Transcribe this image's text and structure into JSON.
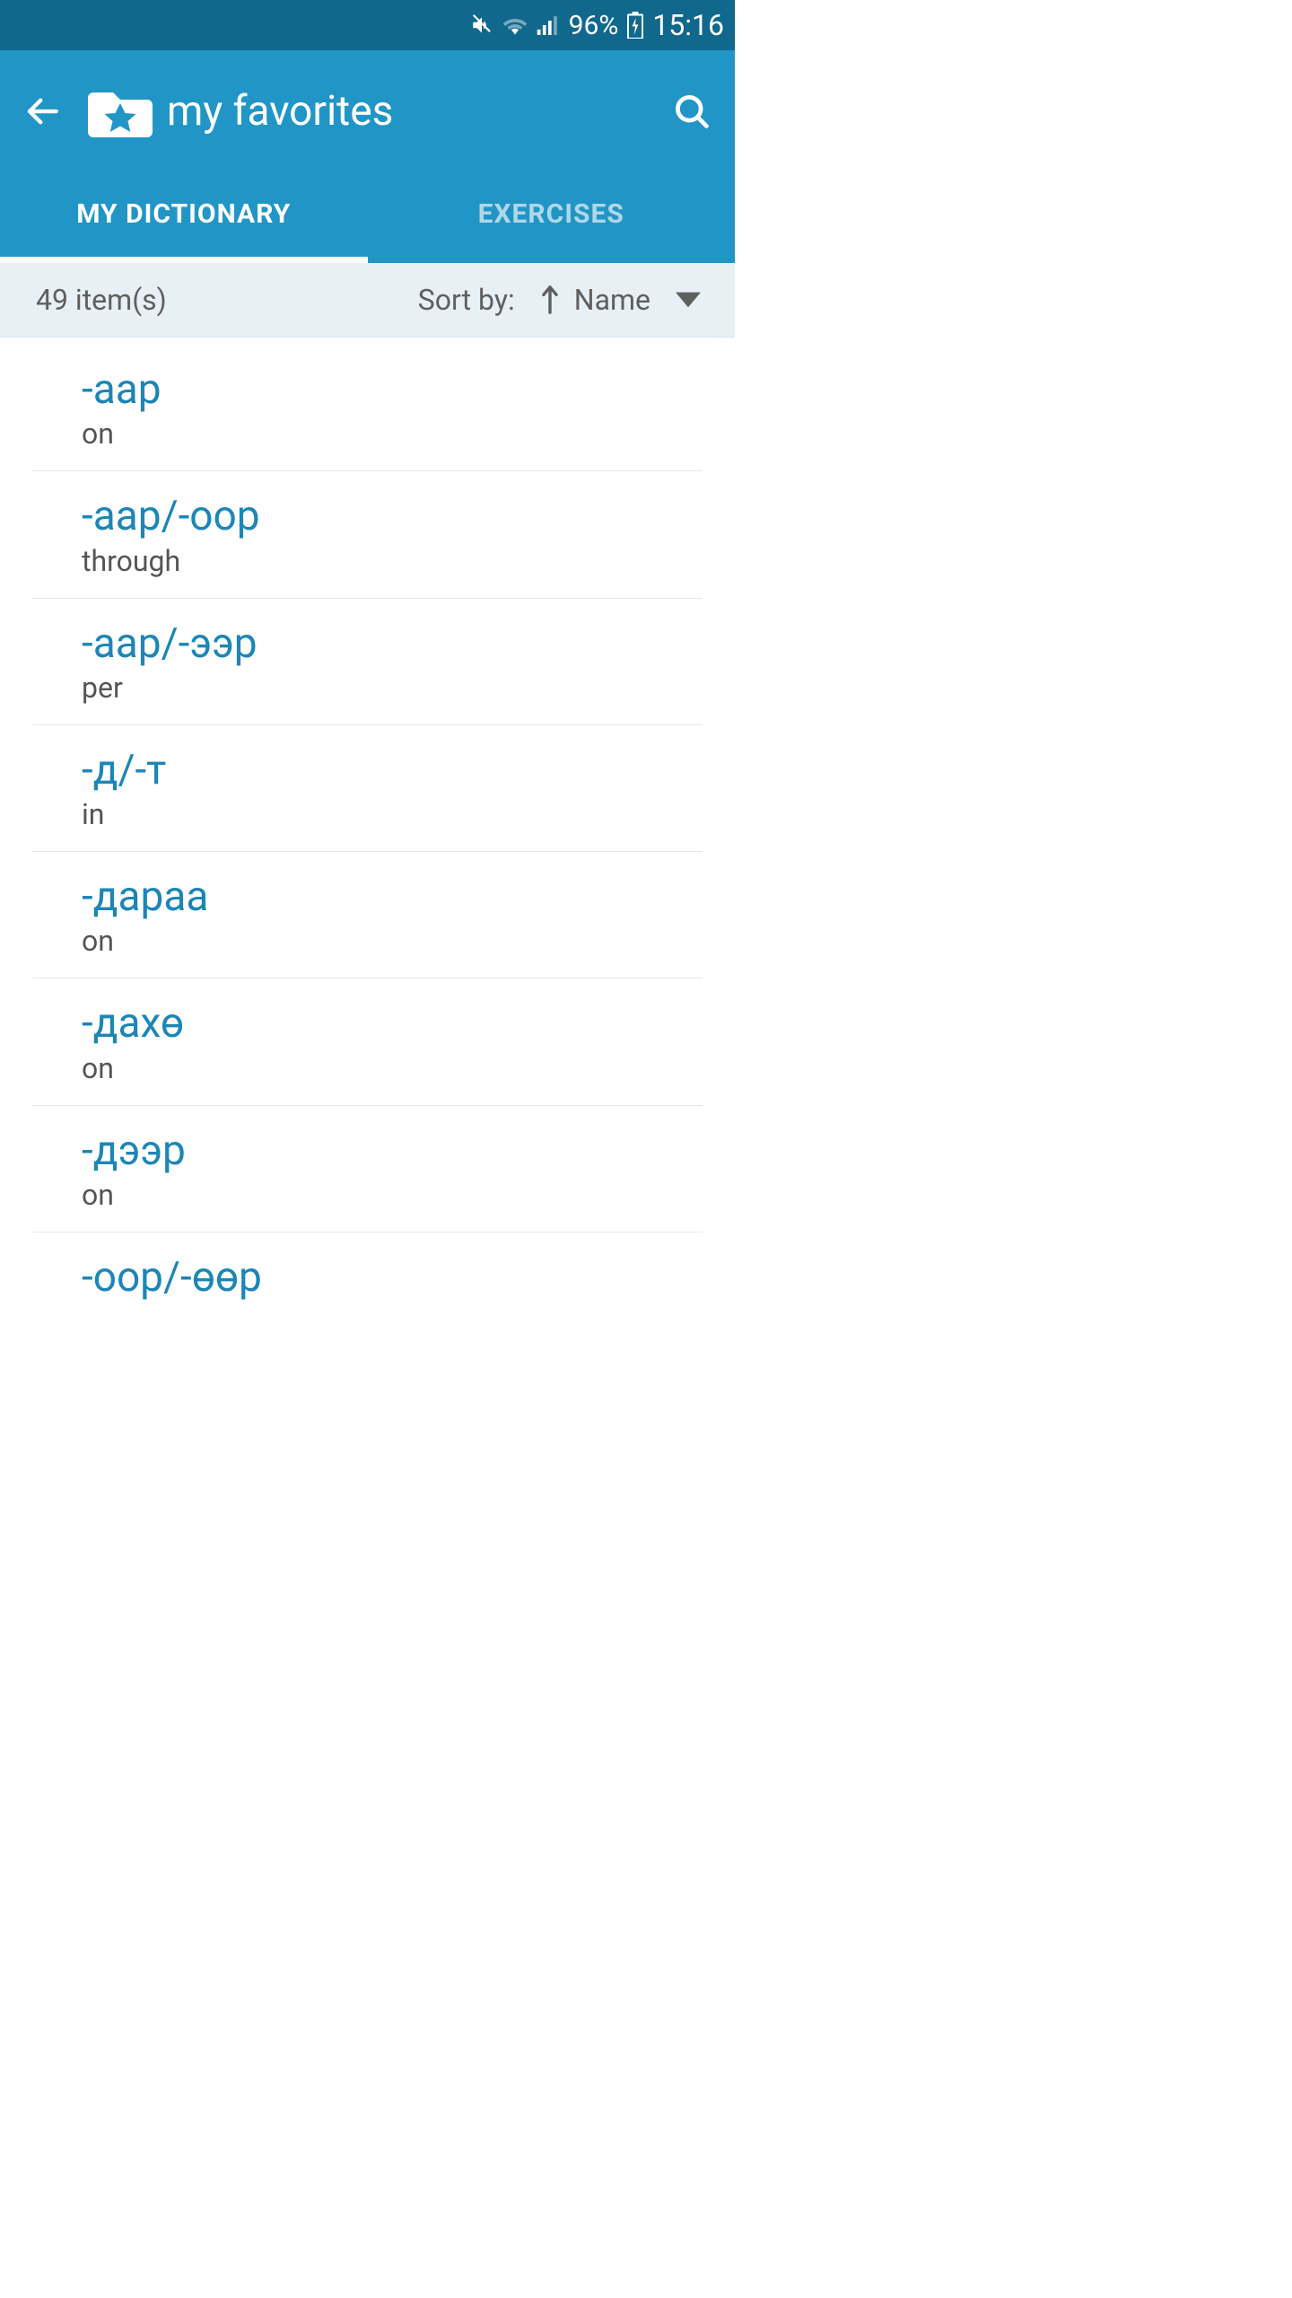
{
  "status": {
    "battery": "96%",
    "time": "15:16"
  },
  "header": {
    "title": "my favorites"
  },
  "tabs": {
    "t0": "MY DICTIONARY",
    "t1": "EXERCISES"
  },
  "info": {
    "count": "49 item(s)",
    "sort_label": "Sort by:",
    "sort_value": "Name"
  },
  "items": [
    {
      "word": "-аар",
      "translation": "on"
    },
    {
      "word": "-аар/-оор",
      "translation": "through"
    },
    {
      "word": "-аар/-ээр",
      "translation": "per"
    },
    {
      "word": "-д/-т",
      "translation": "in"
    },
    {
      "word": "-дараа",
      "translation": "on"
    },
    {
      "word": "-дахө",
      "translation": "on"
    },
    {
      "word": "-дээр",
      "translation": "on"
    },
    {
      "word": "-оор/-өөр",
      "translation": ""
    }
  ]
}
